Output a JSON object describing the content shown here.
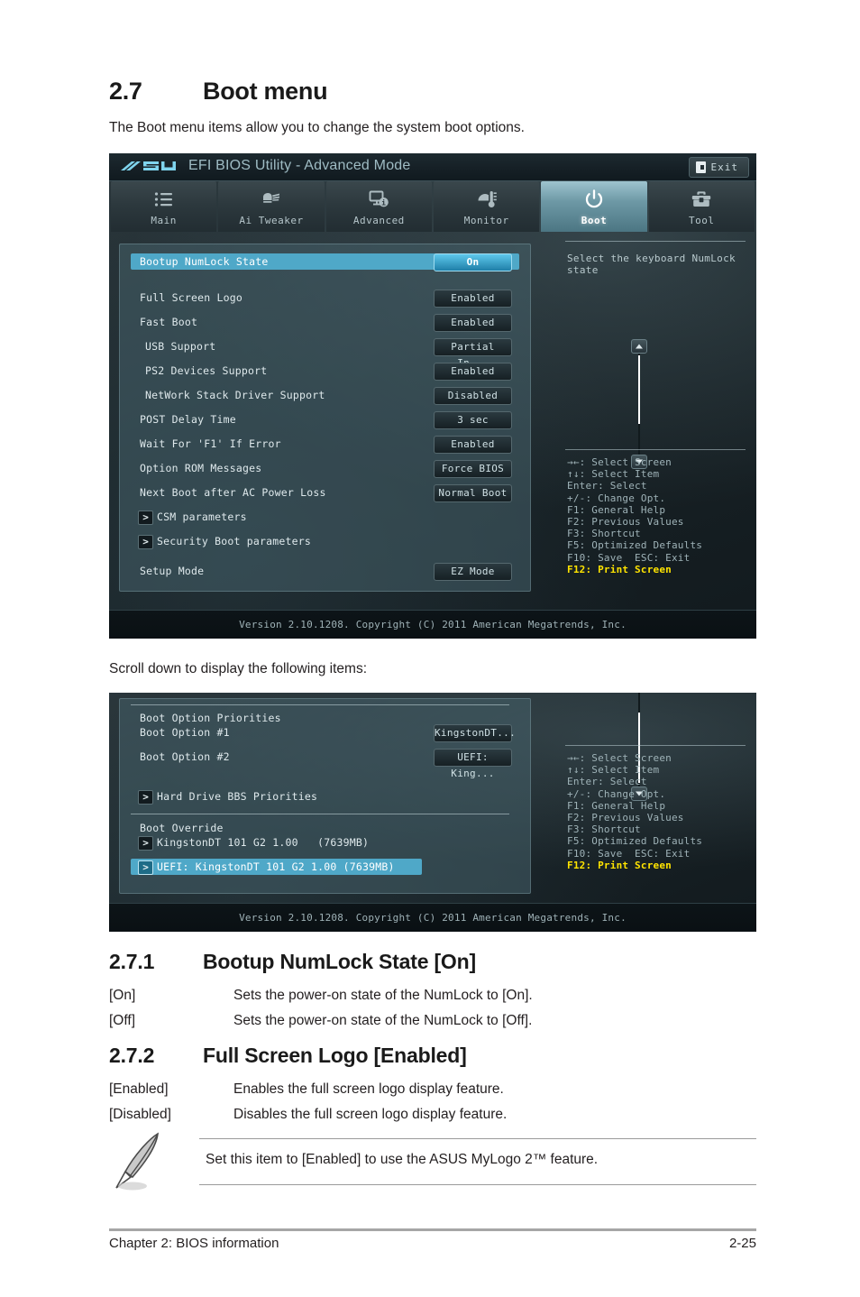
{
  "document": {
    "section_number": "2.7",
    "section_title": "Boot menu",
    "intro": "The Boot menu items allow you to change the system boot options.",
    "scroll_note": "Scroll down to display the following items:",
    "subsection_1": {
      "number": "2.7.1",
      "title": "Bootup NumLock State [On]",
      "rows": [
        {
          "term": "[On]",
          "desc": "Sets the power-on state of the NumLock to [On]."
        },
        {
          "term": "[Off]",
          "desc": "Sets the power-on state of the NumLock to [Off]."
        }
      ]
    },
    "subsection_2": {
      "number": "2.7.2",
      "title": "Full Screen Logo [Enabled]",
      "rows": [
        {
          "term": "[Enabled]",
          "desc": "Enables the full screen logo display feature."
        },
        {
          "term": "[Disabled]",
          "desc": "Disables the full screen logo display feature."
        }
      ]
    },
    "note": "Set this item to [Enabled] to use the ASUS MyLogo 2™ feature.",
    "footer_left": "Chapter 2: BIOS information",
    "footer_right": "2-25"
  },
  "bios": {
    "brand": "ASUS",
    "title": "EFI BIOS Utility - Advanced Mode",
    "exit_label": "Exit",
    "version_text": "Version 2.10.1208. Copyright (C) 2011 American Megatrends, Inc.",
    "tabs": [
      {
        "label": "Main",
        "icon": "list-icon",
        "active": false
      },
      {
        "label": "Ai Tweaker",
        "icon": "tweaker-icon",
        "active": false
      },
      {
        "label": "Advanced",
        "icon": "advanced-icon",
        "active": false
      },
      {
        "label": "Monitor",
        "icon": "monitor-icon",
        "active": false
      },
      {
        "label": "Boot",
        "icon": "power-icon",
        "active": true
      },
      {
        "label": "Tool",
        "icon": "toolbox-icon",
        "active": false
      }
    ],
    "help_keys": "→←: Select Screen\n↑↓: Select Item\nEnter: Select\n+/-: Change Opt.\nF1: General Help\nF2: Previous Values\nF3: Shortcut\nF5: Optimized Defaults\nF10: Save  ESC: Exit\n",
    "help_keys_highlight": "F12: Print Screen",
    "accent_selected": "#4fa8c8",
    "accent_value_on": "#2f9ecb",
    "accent_hotkey": "#ffe400"
  },
  "screen1": {
    "help_text": "Select the keyboard NumLock state",
    "items": [
      {
        "name": "Bootup NumLock State",
        "value": "On",
        "selected": true,
        "indent": 0,
        "kind": "value",
        "value_style": "on"
      },
      {
        "name": "Full Screen Logo",
        "value": "Enabled",
        "selected": false,
        "indent": 0,
        "kind": "value",
        "value_style": "normal"
      },
      {
        "name": "Fast Boot",
        "value": "Enabled",
        "selected": false,
        "indent": 0,
        "kind": "value",
        "value_style": "normal"
      },
      {
        "name": "USB Support",
        "value": "Partial In...",
        "selected": false,
        "indent": 1,
        "kind": "value",
        "value_style": "normal"
      },
      {
        "name": "PS2 Devices Support",
        "value": "Enabled",
        "selected": false,
        "indent": 1,
        "kind": "value",
        "value_style": "normal"
      },
      {
        "name": "NetWork Stack Driver Support",
        "value": "Disabled",
        "selected": false,
        "indent": 1,
        "kind": "value",
        "value_style": "normal"
      },
      {
        "name": "POST Delay Time",
        "value": "3 sec",
        "selected": false,
        "indent": 0,
        "kind": "value",
        "value_style": "normal"
      },
      {
        "name": "Wait For 'F1' If Error",
        "value": "Enabled",
        "selected": false,
        "indent": 0,
        "kind": "value",
        "value_style": "normal"
      },
      {
        "name": "Option ROM Messages",
        "value": "Force BIOS",
        "selected": false,
        "indent": 0,
        "kind": "value",
        "value_style": "normal"
      },
      {
        "name": "Next Boot after AC Power Loss",
        "value": "Normal Boot",
        "selected": false,
        "indent": 0,
        "kind": "value",
        "value_style": "normal"
      },
      {
        "name": "CSM parameters",
        "value": "",
        "selected": false,
        "indent": 0,
        "kind": "submenu",
        "value_style": ""
      },
      {
        "name": "Security Boot parameters",
        "value": "",
        "selected": false,
        "indent": 0,
        "kind": "submenu",
        "value_style": ""
      },
      {
        "name": "Setup Mode",
        "value": "EZ Mode",
        "selected": false,
        "indent": 0,
        "kind": "value",
        "value_style": "normal"
      }
    ]
  },
  "screen2": {
    "group_heading": "Boot Option Priorities",
    "override_heading": "Boot Override",
    "items": [
      {
        "name": "Boot Option #1",
        "value": "KingstonDT...",
        "selected": false,
        "kind": "value"
      },
      {
        "name": "Boot Option #2",
        "value": "UEFI: King...",
        "selected": false,
        "kind": "value"
      },
      {
        "name": "Hard Drive BBS Priorities",
        "value": "",
        "selected": false,
        "kind": "submenu"
      }
    ],
    "override_items": [
      {
        "name": "KingstonDT 101 G2 1.00   (7639MB)",
        "selected": false,
        "kind": "submenu"
      },
      {
        "name": "UEFI: KingstonDT 101 G2 1.00 (7639MB)",
        "selected": true,
        "kind": "submenu"
      }
    ]
  }
}
